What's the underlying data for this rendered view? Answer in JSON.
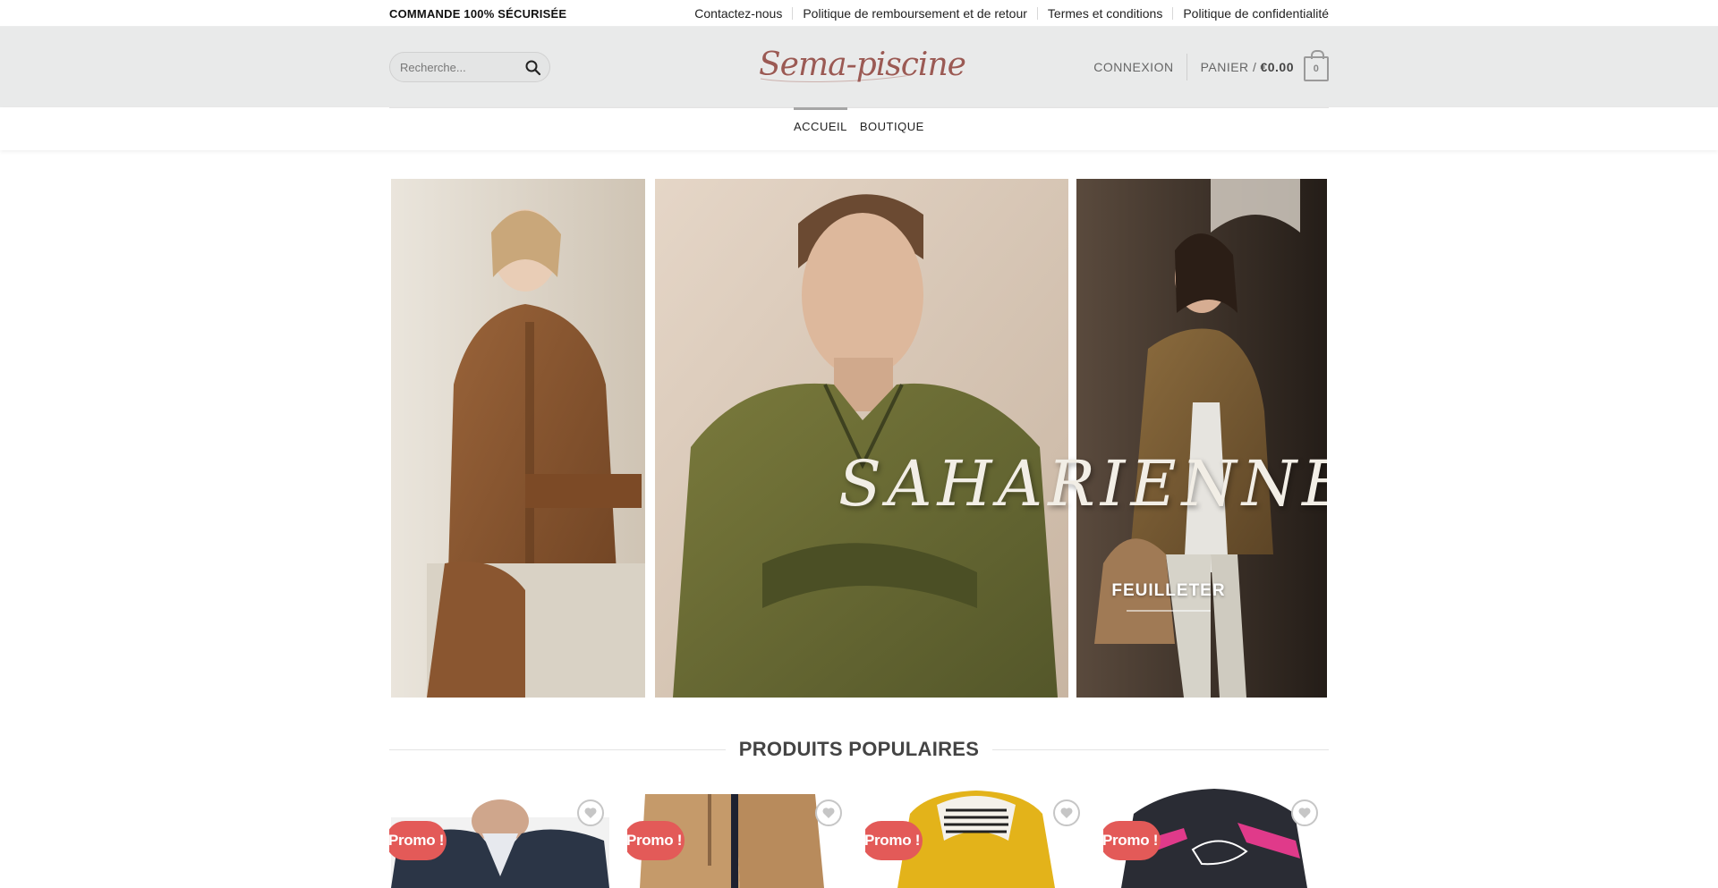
{
  "topbar": {
    "secure_text": "COMMANDE 100% SÉCURISÉE",
    "links": [
      "Contactez-nous",
      "Politique de remboursement et de retour",
      "Termes et conditions",
      "Politique de confidentialité"
    ]
  },
  "header": {
    "search_placeholder": "Recherche...",
    "logo_text": "Sema-piscine",
    "login_label": "CONNEXION",
    "cart_label": "PANIER /",
    "cart_amount": "€0.00",
    "cart_count": "0"
  },
  "nav": {
    "items": [
      "ACCUEIL",
      "BOUTIQUE"
    ],
    "active_index": 0
  },
  "hero": {
    "title": "SAHARIENNE",
    "cta_label": "FEUILLETER"
  },
  "products_section": {
    "title": "PRODUITS POPULAIRES",
    "badge_label": "Promo !",
    "items": [
      {
        "icon": "heart-icon"
      },
      {
        "icon": "heart-icon"
      },
      {
        "icon": "heart-icon"
      },
      {
        "icon": "heart-icon"
      }
    ]
  },
  "colors": {
    "promo_badge": "#e35a58",
    "logo": "#9b5a54",
    "header_bg": "#e9eaea"
  }
}
